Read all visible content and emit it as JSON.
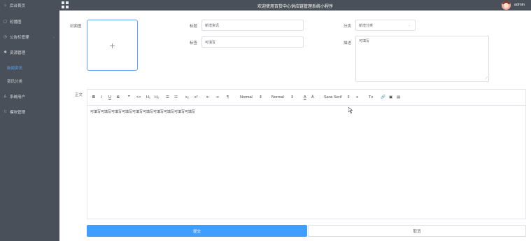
{
  "sidebar": {
    "items": [
      {
        "icon": "⌂",
        "label": "后台首页"
      },
      {
        "icon": "▢",
        "label": "轮播图"
      },
      {
        "icon": "◷",
        "label": "公告栏管理",
        "chevron": "⌄"
      },
      {
        "icon": "✱",
        "label": "资源管理"
      },
      {
        "label": "新闻资讯"
      },
      {
        "label": "资讯分类"
      },
      {
        "icon": "♙",
        "label": "系统用户"
      },
      {
        "icon": "⁞⁞",
        "label": "模块管理"
      }
    ]
  },
  "topbar": {
    "title": "欢迎使用百货中心供应链管理系统小程序",
    "username": "admin"
  },
  "form": {
    "cover_label": "封面图",
    "cover_plus": "+",
    "title_label": "标题",
    "title_value": "新增资讯",
    "tag_label": "标签",
    "tag_value": "可填写",
    "category_label": "分类",
    "category_value": "新增分类",
    "category_arrow": "⌄",
    "desc_label": "描述",
    "desc_value": "可填写",
    "resize_mark": "⟋",
    "content_label": "正文"
  },
  "editor": {
    "toolbar": {
      "bold": "B",
      "italic": "I",
      "underline": "U",
      "strike": "S",
      "quote": "❞",
      "code": "<>",
      "h1": "H₁",
      "h2": "H₂",
      "ol": "☰",
      "ul": "☷",
      "sub": "x₂",
      "sup": "x²",
      "indent_left": "⇤",
      "indent_right": "⇥",
      "direction": "¶",
      "size_value": "Normal",
      "size_arrow": "⇕",
      "header_value": "Normal",
      "header_arrow": "⇕",
      "color": "A",
      "background": "Ā",
      "font_value": "Sans Serif",
      "font_arrow": "⇕",
      "align": "≡",
      "clean": "Tx",
      "link": "🔗",
      "image": "▣",
      "video": "▤"
    },
    "body_text": "可填写可填写可填写可填写可填写可填写可填写可填写可填写可填写"
  },
  "buttons": {
    "submit": "提交",
    "cancel": "取消"
  },
  "colors": {
    "sidebar_bg": "#4a5059",
    "primary": "#409eff",
    "active_menu": "#5aa4f5"
  }
}
